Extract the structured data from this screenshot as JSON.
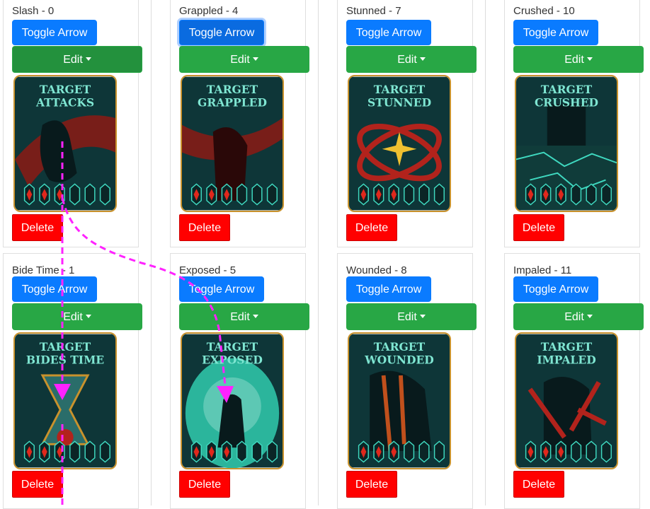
{
  "cards": [
    {
      "title": "Slash - 0",
      "toggle": "Toggle Arrow",
      "edit": "Edit",
      "delete": "Delete",
      "line1": "TARGET",
      "line2": "ATTACKS",
      "art": "slash"
    },
    {
      "title": "Grappled - 4",
      "toggle": "Toggle Arrow",
      "edit": "Edit",
      "delete": "Delete",
      "line1": "TARGET",
      "line2": "GRAPPLED",
      "art": "grappled"
    },
    {
      "title": "Stunned - 7",
      "toggle": "Toggle Arrow",
      "edit": "Edit",
      "delete": "Delete",
      "line1": "TARGET",
      "line2": "STUNNED",
      "art": "stunned"
    },
    {
      "title": "Crushed - 10",
      "toggle": "Toggle Arrow",
      "edit": "Edit",
      "delete": "Delete",
      "line1": "TARGET",
      "line2": "CRUSHED",
      "art": "crushed"
    },
    {
      "title": "Bide Time - 1",
      "toggle": "Toggle Arrow",
      "edit": "Edit",
      "delete": "Delete",
      "line1": "TARGET",
      "line2": "BIDES TIME",
      "art": "bide"
    },
    {
      "title": "Exposed - 5",
      "toggle": "Toggle Arrow",
      "edit": "Edit",
      "delete": "Delete",
      "line1": "TARGET",
      "line2": "EXPOSED",
      "art": "exposed"
    },
    {
      "title": "Wounded - 8",
      "toggle": "Toggle Arrow",
      "edit": "Edit",
      "delete": "Delete",
      "line1": "TARGET",
      "line2": "WOUNDED",
      "art": "wounded"
    },
    {
      "title": "Impaled - 11",
      "toggle": "Toggle Arrow",
      "edit": "Edit",
      "delete": "Delete",
      "line1": "TARGET",
      "line2": "IMPALED",
      "art": "impaled"
    }
  ],
  "colors": {
    "toggle": "#0a7bff",
    "edit": "#28a745",
    "delete": "#ff0000",
    "card_bg": "#0f3a3c",
    "card_title": "#7fe6d2",
    "card_border": "#c9922c",
    "arrow": "#ff22ff"
  }
}
